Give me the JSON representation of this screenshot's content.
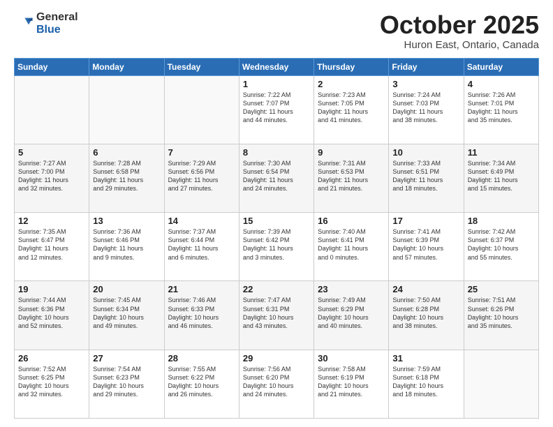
{
  "header": {
    "logo": {
      "general": "General",
      "blue": "Blue"
    },
    "title": "October 2025",
    "subtitle": "Huron East, Ontario, Canada"
  },
  "calendar": {
    "days_of_week": [
      "Sunday",
      "Monday",
      "Tuesday",
      "Wednesday",
      "Thursday",
      "Friday",
      "Saturday"
    ],
    "weeks": [
      [
        {
          "day": "",
          "info": ""
        },
        {
          "day": "",
          "info": ""
        },
        {
          "day": "",
          "info": ""
        },
        {
          "day": "1",
          "info": "Sunrise: 7:22 AM\nSunset: 7:07 PM\nDaylight: 11 hours\nand 44 minutes."
        },
        {
          "day": "2",
          "info": "Sunrise: 7:23 AM\nSunset: 7:05 PM\nDaylight: 11 hours\nand 41 minutes."
        },
        {
          "day": "3",
          "info": "Sunrise: 7:24 AM\nSunset: 7:03 PM\nDaylight: 11 hours\nand 38 minutes."
        },
        {
          "day": "4",
          "info": "Sunrise: 7:26 AM\nSunset: 7:01 PM\nDaylight: 11 hours\nand 35 minutes."
        }
      ],
      [
        {
          "day": "5",
          "info": "Sunrise: 7:27 AM\nSunset: 7:00 PM\nDaylight: 11 hours\nand 32 minutes."
        },
        {
          "day": "6",
          "info": "Sunrise: 7:28 AM\nSunset: 6:58 PM\nDaylight: 11 hours\nand 29 minutes."
        },
        {
          "day": "7",
          "info": "Sunrise: 7:29 AM\nSunset: 6:56 PM\nDaylight: 11 hours\nand 27 minutes."
        },
        {
          "day": "8",
          "info": "Sunrise: 7:30 AM\nSunset: 6:54 PM\nDaylight: 11 hours\nand 24 minutes."
        },
        {
          "day": "9",
          "info": "Sunrise: 7:31 AM\nSunset: 6:53 PM\nDaylight: 11 hours\nand 21 minutes."
        },
        {
          "day": "10",
          "info": "Sunrise: 7:33 AM\nSunset: 6:51 PM\nDaylight: 11 hours\nand 18 minutes."
        },
        {
          "day": "11",
          "info": "Sunrise: 7:34 AM\nSunset: 6:49 PM\nDaylight: 11 hours\nand 15 minutes."
        }
      ],
      [
        {
          "day": "12",
          "info": "Sunrise: 7:35 AM\nSunset: 6:47 PM\nDaylight: 11 hours\nand 12 minutes."
        },
        {
          "day": "13",
          "info": "Sunrise: 7:36 AM\nSunset: 6:46 PM\nDaylight: 11 hours\nand 9 minutes."
        },
        {
          "day": "14",
          "info": "Sunrise: 7:37 AM\nSunset: 6:44 PM\nDaylight: 11 hours\nand 6 minutes."
        },
        {
          "day": "15",
          "info": "Sunrise: 7:39 AM\nSunset: 6:42 PM\nDaylight: 11 hours\nand 3 minutes."
        },
        {
          "day": "16",
          "info": "Sunrise: 7:40 AM\nSunset: 6:41 PM\nDaylight: 11 hours\nand 0 minutes."
        },
        {
          "day": "17",
          "info": "Sunrise: 7:41 AM\nSunset: 6:39 PM\nDaylight: 10 hours\nand 57 minutes."
        },
        {
          "day": "18",
          "info": "Sunrise: 7:42 AM\nSunset: 6:37 PM\nDaylight: 10 hours\nand 55 minutes."
        }
      ],
      [
        {
          "day": "19",
          "info": "Sunrise: 7:44 AM\nSunset: 6:36 PM\nDaylight: 10 hours\nand 52 minutes."
        },
        {
          "day": "20",
          "info": "Sunrise: 7:45 AM\nSunset: 6:34 PM\nDaylight: 10 hours\nand 49 minutes."
        },
        {
          "day": "21",
          "info": "Sunrise: 7:46 AM\nSunset: 6:33 PM\nDaylight: 10 hours\nand 46 minutes."
        },
        {
          "day": "22",
          "info": "Sunrise: 7:47 AM\nSunset: 6:31 PM\nDaylight: 10 hours\nand 43 minutes."
        },
        {
          "day": "23",
          "info": "Sunrise: 7:49 AM\nSunset: 6:29 PM\nDaylight: 10 hours\nand 40 minutes."
        },
        {
          "day": "24",
          "info": "Sunrise: 7:50 AM\nSunset: 6:28 PM\nDaylight: 10 hours\nand 38 minutes."
        },
        {
          "day": "25",
          "info": "Sunrise: 7:51 AM\nSunset: 6:26 PM\nDaylight: 10 hours\nand 35 minutes."
        }
      ],
      [
        {
          "day": "26",
          "info": "Sunrise: 7:52 AM\nSunset: 6:25 PM\nDaylight: 10 hours\nand 32 minutes."
        },
        {
          "day": "27",
          "info": "Sunrise: 7:54 AM\nSunset: 6:23 PM\nDaylight: 10 hours\nand 29 minutes."
        },
        {
          "day": "28",
          "info": "Sunrise: 7:55 AM\nSunset: 6:22 PM\nDaylight: 10 hours\nand 26 minutes."
        },
        {
          "day": "29",
          "info": "Sunrise: 7:56 AM\nSunset: 6:20 PM\nDaylight: 10 hours\nand 24 minutes."
        },
        {
          "day": "30",
          "info": "Sunrise: 7:58 AM\nSunset: 6:19 PM\nDaylight: 10 hours\nand 21 minutes."
        },
        {
          "day": "31",
          "info": "Sunrise: 7:59 AM\nSunset: 6:18 PM\nDaylight: 10 hours\nand 18 minutes."
        },
        {
          "day": "",
          "info": ""
        }
      ]
    ]
  }
}
